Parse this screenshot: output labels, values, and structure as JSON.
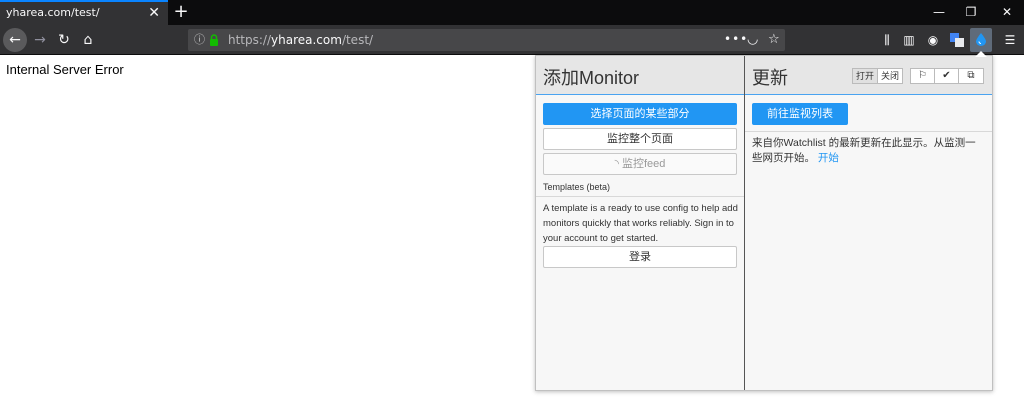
{
  "tab": {
    "title": "yharea.com/test/"
  },
  "url": {
    "prefix": "https://",
    "host": "yharea.com",
    "path": "/test/"
  },
  "page": {
    "error_text": "Internal Server Error"
  },
  "popup": {
    "left": {
      "title": "添加Monitor",
      "select_parts_label": "选择页面的某些部分",
      "monitor_page_label": "监控整个页面",
      "monitor_feed_label": "监控feed",
      "templates_label": "Templates (beta)",
      "templates_help": "A template is a ready to use config to help add monitors quickly that works reliably. Sign in to your account to get started.",
      "login_label": "登录"
    },
    "right": {
      "title": "更新",
      "toggle_on": "打开",
      "toggle_off": "关闭",
      "goto_watchlist_label": "前往监视列表",
      "info_text": "来自你Watchlist 的最新更新在此显示。从监测一些网页开始。",
      "start_link": "开始"
    }
  },
  "colors": {
    "accent": "#2196f3",
    "chrome_dark": "#0c0c0d",
    "toolbar": "#323234"
  }
}
